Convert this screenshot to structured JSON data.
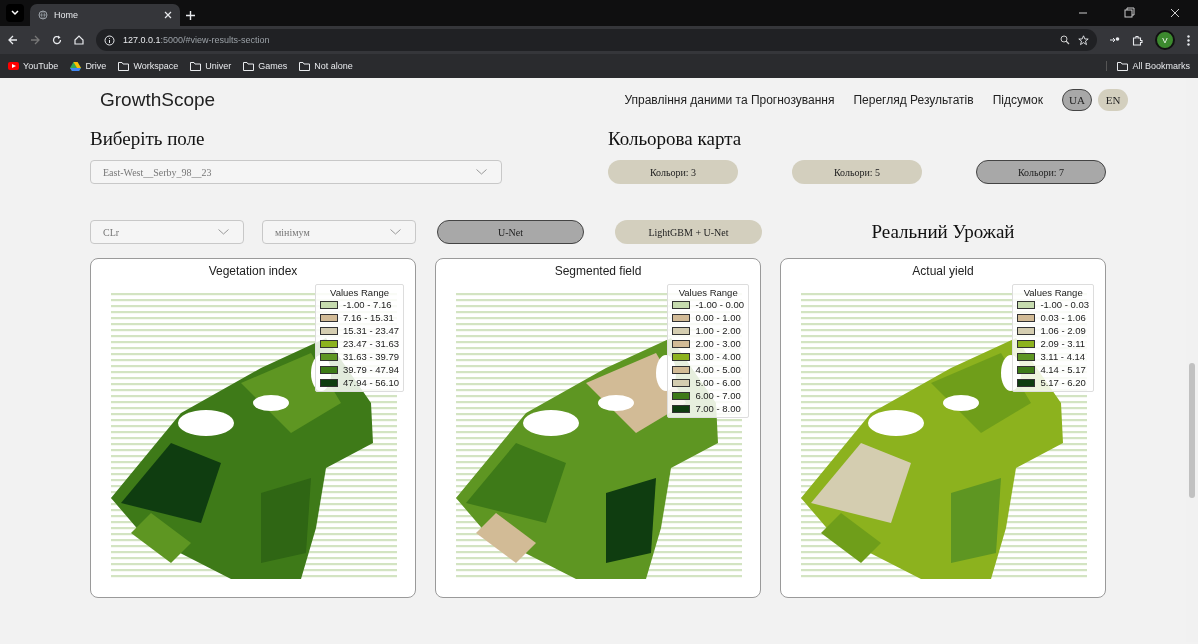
{
  "browser": {
    "tabs": [
      {
        "title": "Home",
        "selected": true
      }
    ],
    "url": {
      "host": "127.0.0.1",
      "rest": ":5000/#view-results-section"
    },
    "avatar": "V",
    "bookmarks": [
      {
        "label": "YouTube",
        "kind": "youtube"
      },
      {
        "label": "Drive",
        "kind": "drive"
      },
      {
        "label": "Workspace",
        "kind": "folder"
      },
      {
        "label": "Univer",
        "kind": "folder"
      },
      {
        "label": "Games",
        "kind": "folder"
      },
      {
        "label": "Not alone",
        "kind": "folder"
      }
    ],
    "all_bookmarks": "All Bookmarks"
  },
  "header": {
    "brand": "GrowthScope",
    "nav": [
      "Управління даними та Прогнозування",
      "Перегляд Результатів",
      "Підсумок"
    ],
    "languages": [
      {
        "label": "UA",
        "selected": true
      },
      {
        "label": "EN",
        "selected": false
      }
    ]
  },
  "field_section": {
    "title": "Виберіть поле",
    "select": "East-West__Serby_98__23"
  },
  "colormap_section": {
    "title": "Кольорова карта",
    "buttons": [
      {
        "label": "Кольори: 3",
        "selected": false
      },
      {
        "label": "Кольори: 5",
        "selected": false
      },
      {
        "label": "Кольори: 7",
        "selected": true
      }
    ]
  },
  "index_select": "CLr",
  "aggregation_select": "мінімум",
  "models": [
    {
      "label": "U-Net",
      "selected": true
    },
    {
      "label": "LightGBM + U-Net",
      "selected": false
    }
  ],
  "actual_title": "Реальний Урожай",
  "cards": [
    {
      "title": "Vegetation index",
      "legend_title": "Values Range",
      "legend": [
        {
          "label": "-1.00 - 7.16",
          "color": "#c6dbae"
        },
        {
          "label": "7.16 - 15.31",
          "color": "#d2bb96"
        },
        {
          "label": "15.31 - 23.47",
          "color": "#d4cdb0"
        },
        {
          "label": "23.47 - 31.63",
          "color": "#8cb21e"
        },
        {
          "label": "31.63 - 39.79",
          "color": "#5e9622"
        },
        {
          "label": "39.79 - 47.94",
          "color": "#3e7a18"
        },
        {
          "label": "47.94 - 56.10",
          "color": "#0f3d10"
        }
      ]
    },
    {
      "title": "Segmented field",
      "legend_title": "Values Range",
      "legend": [
        {
          "label": "-1.00 - 0.00",
          "color": "#c6dbae"
        },
        {
          "label": "0.00 - 1.00",
          "color": "#d2bb96"
        },
        {
          "label": "1.00 - 2.00",
          "color": "#d4cdb0"
        },
        {
          "label": "2.00 - 3.00",
          "color": "#d2bb96"
        },
        {
          "label": "3.00 - 4.00",
          "color": "#8cb21e"
        },
        {
          "label": "4.00 - 5.00",
          "color": "#d2bb96"
        },
        {
          "label": "5.00 - 6.00",
          "color": "#d4cdb0"
        },
        {
          "label": "6.00 - 7.00",
          "color": "#3e7a18"
        },
        {
          "label": "7.00 - 8.00",
          "color": "#0f3d10"
        }
      ]
    },
    {
      "title": "Actual yield",
      "legend_title": "Values Range",
      "legend": [
        {
          "label": "-1.00 - 0.03",
          "color": "#c6dbae"
        },
        {
          "label": "0.03 - 1.06",
          "color": "#d2bb96"
        },
        {
          "label": "1.06 - 2.09",
          "color": "#d4cdb0"
        },
        {
          "label": "2.09 - 3.11",
          "color": "#8cb21e"
        },
        {
          "label": "3.11 - 4.14",
          "color": "#5e9622"
        },
        {
          "label": "4.14 - 5.17",
          "color": "#3e7a18"
        },
        {
          "label": "5.17 - 6.20",
          "color": "#0f3d10"
        }
      ]
    }
  ]
}
